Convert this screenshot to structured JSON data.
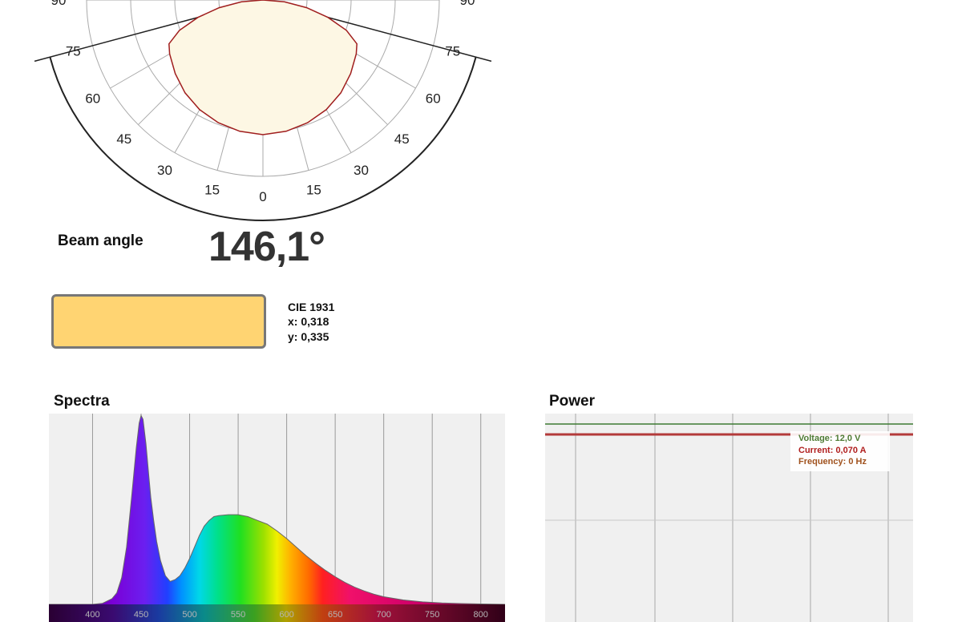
{
  "beam": {
    "label": "Beam angle",
    "value": "146,1°"
  },
  "color": {
    "swatch": "#FFD472",
    "cie_title": "CIE 1931",
    "cie_x": "x: 0,318",
    "cie_y": "y: 0,335"
  },
  "sections": {
    "spectra_title": "Spectra",
    "power_title": "Power"
  },
  "power": {
    "voltage": "Voltage: 12,0 V",
    "current": "Current: 0,070 A",
    "frequency": "Frequency: 0 Hz",
    "voltage_color": "#4E7A33",
    "current_color": "#B01E1E",
    "frequency_color": "#A0521E"
  },
  "chart_data": [
    {
      "type": "polar",
      "angle_labels": [
        "0",
        "15",
        "30",
        "45",
        "60",
        "75",
        "90"
      ],
      "series": [
        {
          "angles": [
            0,
            10,
            20,
            30,
            40,
            50,
            60,
            65,
            70,
            75,
            80,
            85,
            90
          ],
          "values": [
            1.0,
            0.99,
            0.97,
            0.94,
            0.9,
            0.85,
            0.8,
            0.77,
            0.66,
            0.5,
            0.33,
            0.16,
            0.0
          ]
        }
      ],
      "line_color": "#A01E1E",
      "fill_color": "#FDF7E4"
    },
    {
      "type": "area",
      "x_ticks": [
        400,
        450,
        500,
        550,
        600,
        650,
        700,
        750,
        800
      ],
      "xlim": [
        355,
        825
      ],
      "ylim": [
        0,
        1
      ],
      "x": [
        355,
        380,
        400,
        410,
        420,
        425,
        430,
        435,
        440,
        445,
        448,
        450,
        452,
        455,
        458,
        460,
        463,
        466,
        470,
        475,
        480,
        485,
        490,
        495,
        500,
        505,
        510,
        515,
        520,
        525,
        530,
        540,
        550,
        560,
        570,
        580,
        590,
        600,
        610,
        620,
        630,
        640,
        650,
        660,
        670,
        680,
        690,
        700,
        720,
        740,
        760,
        780,
        800,
        825
      ],
      "y": [
        0,
        0,
        0,
        0.005,
        0.03,
        0.06,
        0.14,
        0.3,
        0.55,
        0.82,
        0.95,
        0.99,
        0.97,
        0.84,
        0.67,
        0.56,
        0.44,
        0.33,
        0.23,
        0.15,
        0.12,
        0.13,
        0.15,
        0.19,
        0.24,
        0.3,
        0.36,
        0.41,
        0.44,
        0.46,
        0.465,
        0.47,
        0.47,
        0.46,
        0.44,
        0.42,
        0.385,
        0.345,
        0.3,
        0.255,
        0.215,
        0.178,
        0.145,
        0.115,
        0.09,
        0.07,
        0.053,
        0.04,
        0.023,
        0.013,
        0.007,
        0.004,
        0.002,
        0
      ]
    },
    {
      "type": "line",
      "series": [
        {
          "values": [
            12.0
          ],
          "color": "#3C7A32"
        },
        {
          "values": [
            0.07
          ],
          "color": "#B33A3A"
        }
      ]
    }
  ]
}
